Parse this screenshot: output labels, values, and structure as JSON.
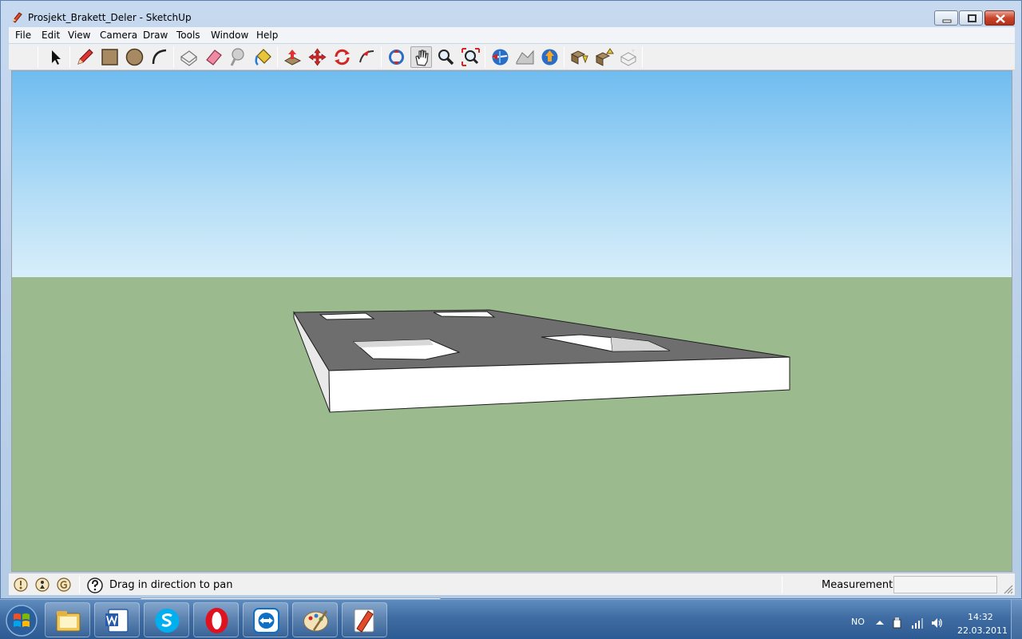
{
  "window": {
    "title": "Prosjekt_Brakett_Deler - SketchUp"
  },
  "menu": {
    "items": [
      "File",
      "Edit",
      "View",
      "Camera",
      "Draw",
      "Tools",
      "Window",
      "Help"
    ]
  },
  "toolbar": {
    "tools": [
      "select-icon",
      "pencil-icon",
      "rectangle-icon",
      "circle-icon",
      "arc-icon",
      "make-component-icon",
      "eraser-icon",
      "tape-measure-icon",
      "paint-bucket-icon",
      "push-pull-icon",
      "move-icon",
      "rotate-icon",
      "follow-me-icon",
      "orbit-icon",
      "pan-icon",
      "zoom-icon",
      "zoom-extents-icon",
      "get-current-view-icon",
      "toggle-terrain-icon",
      "place-model-icon",
      "get-models-icon",
      "share-model-icon",
      "share-component-icon"
    ],
    "active_tool": "pan-icon"
  },
  "viewport": {
    "sky_color": "#8fcaf2",
    "ground_color": "#9bbb8f",
    "model_top_color": "#6e6e6e",
    "model_side_color": "#ffffff"
  },
  "statusbar": {
    "hint": "Drag in direction to pan",
    "measurements_label": "Measurements",
    "measurements_value": ""
  },
  "taskbar": {
    "apps": [
      "windows-explorer-icon",
      "word-icon",
      "skype-icon",
      "opera-icon",
      "teamviewer-icon",
      "paint-icon",
      "sketchup-icon"
    ],
    "language": "NO",
    "time": "14:32",
    "date": "22.03.2011"
  }
}
